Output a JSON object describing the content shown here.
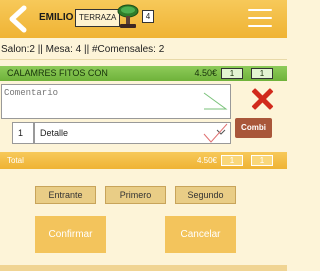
{
  "header": {
    "waiter_name": "EMILIO",
    "zone": "TERRAZA",
    "table_icon": "table-icon",
    "guest_count": "4"
  },
  "info_line": "Salon:2 || Mesa: 4 || #Comensales: 2",
  "item": {
    "name": "CALAMRES FITOS CON",
    "price": "4.50€",
    "qty_a": "1",
    "qty_b": "1"
  },
  "comment": {
    "placeholder": "Comentario",
    "value": ""
  },
  "detail": {
    "quantity": "1",
    "selected": "Detalle"
  },
  "combi_label": "Combi",
  "total": {
    "label": "Total",
    "price": "4.50€",
    "qty_a": "1",
    "qty_b": "1"
  },
  "courses": [
    "Entrante",
    "Primero",
    "Segundo"
  ],
  "actions": {
    "confirm": "Confirmar",
    "cancel": "Cancelar"
  },
  "colors": {
    "header": "#efb334",
    "item_row": "#7fbf4a",
    "delete": "#d12a1c",
    "combi": "#a9573a",
    "course_button": "#e9cd86",
    "action_button": "#f3c45c",
    "background": "#fdf4d8"
  }
}
